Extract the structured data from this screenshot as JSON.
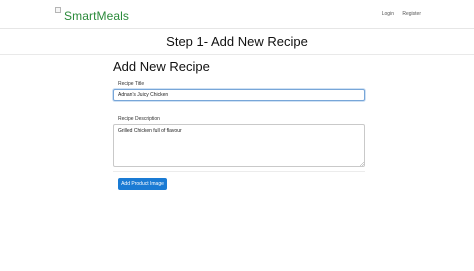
{
  "navbar": {
    "brand": "SmartMeals",
    "links": [
      "Login",
      "Register"
    ]
  },
  "page": {
    "step_title": "Step 1- Add New Recipe"
  },
  "form": {
    "heading": "Add New Recipe",
    "title_label": "Recipe Title",
    "title_value": "Adnan's Juicy Chicken",
    "description_label": "Recipe Description",
    "description_value": "Grilled Chicken full of flavour",
    "add_image_button": "Add Product Image"
  },
  "colors": {
    "brand": "#2a8a3a",
    "primary_button": "#1a7bd4",
    "focus_border": "#78a6d8"
  }
}
